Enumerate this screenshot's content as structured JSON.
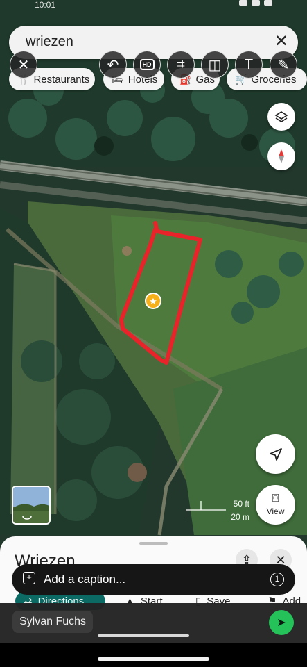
{
  "status": {
    "time": "10:01"
  },
  "search": {
    "query": "wriezen",
    "clear_icon": "close-icon"
  },
  "toolbar": [
    {
      "name": "close-edit-button",
      "icon": "close-icon",
      "glyph": "✕"
    },
    {
      "name": "undo-button",
      "icon": "undo-icon",
      "glyph": "↶"
    },
    {
      "name": "hd-button",
      "icon": "hd-icon",
      "glyph": "HD"
    },
    {
      "name": "crop-button",
      "icon": "crop-icon",
      "glyph": "⌗"
    },
    {
      "name": "sticker-button",
      "icon": "sticker-icon",
      "glyph": "◫"
    },
    {
      "name": "text-button",
      "icon": "text-icon",
      "glyph": "T"
    },
    {
      "name": "draw-button",
      "icon": "pencil-icon",
      "glyph": "✎"
    }
  ],
  "chips": [
    {
      "label": "Restaurants",
      "icon": "restaurant-icon"
    },
    {
      "label": "Hotels",
      "icon": "hotel-icon"
    },
    {
      "label": "Gas",
      "icon": "gas-icon"
    },
    {
      "label": "Groceries",
      "icon": "cart-icon"
    }
  ],
  "map": {
    "scale_ft": "50 ft",
    "scale_m": "20 m",
    "view_label": "View",
    "drawing_color": "#e8232a",
    "marker_color": "#f5b01a"
  },
  "sheet": {
    "place": "Wriezen",
    "actions": [
      "Directions",
      "Start",
      "Save",
      "Add"
    ]
  },
  "caption": {
    "placeholder": "Add a caption...",
    "count": "1"
  },
  "message": {
    "recipient": "Sylvan Fuchs"
  }
}
